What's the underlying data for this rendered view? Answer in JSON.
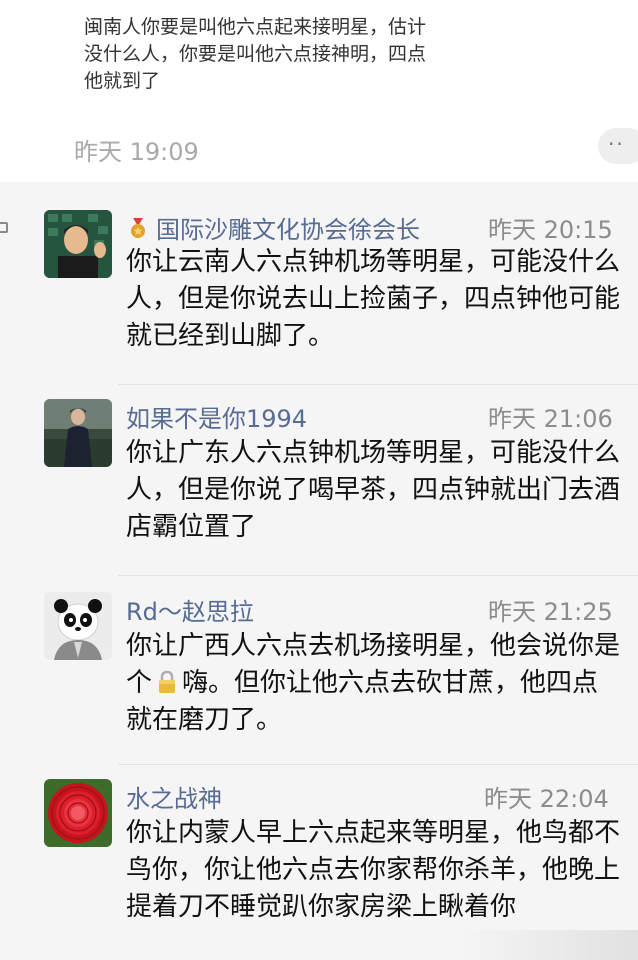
{
  "previous_comment": {
    "text": "闽南人你要是叫他六点起来接明星，估计没什么人，你要是叫他六点接神明，四点他就到了",
    "time": "昨天 19:09",
    "more_label": "··"
  },
  "comments": [
    {
      "name": "国际沙雕文化协会徐会长",
      "badge": "medal-icon",
      "time": "昨天 20:15",
      "text": "你让云南人六点钟机场等明星，可能没什么人，但是你说去山上捡菌子，四点钟他可能就已经到山脚了。"
    },
    {
      "name": "如果不是你1994",
      "time": "昨天 21:06",
      "text": "你让广东人六点钟机场等明星，可能没什么人，但是你说了喝早茶，四点钟就出门去酒店霸位置了"
    },
    {
      "name": "Rd～赵思拉",
      "time": "昨天 21:25",
      "text_before": "你让广西人六点去机场接明星，他会说你是个",
      "text_after": "嗨。但你让他六点去砍甘蔗，他四点就在磨刀了。",
      "inline_icon": "lock-icon"
    },
    {
      "name": "水之战神",
      "time": "昨天 22:04",
      "text": "你让内蒙人早上六点起来等明星，他鸟都不鸟你，你让他六点去你家帮你杀羊，他晚上提着刀不睡觉趴你家房梁上瞅着你"
    }
  ],
  "colors": {
    "name": "#576b95",
    "time": "#8c8c8c",
    "text": "#111111"
  }
}
